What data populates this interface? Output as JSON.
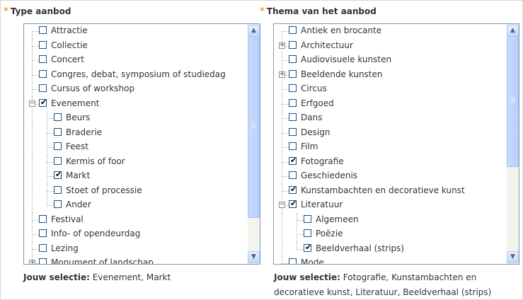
{
  "left": {
    "title": "Type aanbod",
    "selection_label": "Jouw selectie:",
    "selection_value": "Evenement, Markt",
    "items": [
      {
        "label": "Attractie",
        "checked": false,
        "level": 0,
        "expander": ""
      },
      {
        "label": "Collectie",
        "checked": false,
        "level": 0,
        "expander": ""
      },
      {
        "label": "Concert",
        "checked": false,
        "level": 0,
        "expander": ""
      },
      {
        "label": "Congres, debat, symposium of studiedag",
        "checked": false,
        "level": 0,
        "expander": ""
      },
      {
        "label": "Cursus of workshop",
        "checked": false,
        "level": 0,
        "expander": ""
      },
      {
        "label": "Evenement",
        "checked": true,
        "level": 0,
        "expander": "−"
      },
      {
        "label": "Beurs",
        "checked": false,
        "level": 1,
        "expander": ""
      },
      {
        "label": "Braderie",
        "checked": false,
        "level": 1,
        "expander": ""
      },
      {
        "label": "Feest",
        "checked": false,
        "level": 1,
        "expander": ""
      },
      {
        "label": "Kermis of foor",
        "checked": false,
        "level": 1,
        "expander": ""
      },
      {
        "label": "Markt",
        "checked": true,
        "level": 1,
        "expander": ""
      },
      {
        "label": "Stoet of processie",
        "checked": false,
        "level": 1,
        "expander": ""
      },
      {
        "label": "Ander",
        "checked": false,
        "level": 1,
        "expander": ""
      },
      {
        "label": "Festival",
        "checked": false,
        "level": 0,
        "expander": ""
      },
      {
        "label": "Info- of opendeurdag",
        "checked": false,
        "level": 0,
        "expander": ""
      },
      {
        "label": "Lezing",
        "checked": false,
        "level": 0,
        "expander": ""
      },
      {
        "label": "Monument of landschap",
        "checked": false,
        "level": 0,
        "expander": "+"
      }
    ],
    "scroll_position": 0.0
  },
  "right": {
    "title": "Thema van het aanbod",
    "selection_label": "Jouw selectie:",
    "selection_value": "Fotografie, Kunstambachten en decoratieve kunst, Literatuur, Beeldverhaal (strips)",
    "items": [
      {
        "label": "Antiek en brocante",
        "checked": false,
        "level": 0,
        "expander": ""
      },
      {
        "label": "Architectuur",
        "checked": false,
        "level": 0,
        "expander": "+"
      },
      {
        "label": "Audiovisuele kunsten",
        "checked": false,
        "level": 0,
        "expander": ""
      },
      {
        "label": "Beeldende kunsten",
        "checked": false,
        "level": 0,
        "expander": "+"
      },
      {
        "label": "Circus",
        "checked": false,
        "level": 0,
        "expander": ""
      },
      {
        "label": "Erfgoed",
        "checked": false,
        "level": 0,
        "expander": ""
      },
      {
        "label": "Dans",
        "checked": false,
        "level": 0,
        "expander": ""
      },
      {
        "label": "Design",
        "checked": false,
        "level": 0,
        "expander": ""
      },
      {
        "label": "Film",
        "checked": false,
        "level": 0,
        "expander": ""
      },
      {
        "label": "Fotografie",
        "checked": true,
        "level": 0,
        "expander": ""
      },
      {
        "label": "Geschiedenis",
        "checked": false,
        "level": 0,
        "expander": ""
      },
      {
        "label": "Kunstambachten en decoratieve kunst",
        "checked": true,
        "level": 0,
        "expander": ""
      },
      {
        "label": "Literatuur",
        "checked": true,
        "level": 0,
        "expander": "−"
      },
      {
        "label": "Algemeen",
        "checked": false,
        "level": 1,
        "expander": ""
      },
      {
        "label": "Poëzie",
        "checked": false,
        "level": 1,
        "expander": ""
      },
      {
        "label": "Beeldverhaal (strips)",
        "checked": true,
        "level": 1,
        "expander": ""
      },
      {
        "label": "Mode",
        "checked": false,
        "level": 0,
        "expander": ""
      }
    ],
    "scroll_position": 0.0
  },
  "colors": {
    "required_star": "#f2a418",
    "box_border": "#7f9db9",
    "scrollbar_thumb": "#b9cffb"
  },
  "icons": {
    "required": "asterisk-icon",
    "checked": "checkmark-icon",
    "expand": "plus-icon",
    "collapse": "minus-icon",
    "scroll_up": "chevron-up-icon",
    "scroll_down": "chevron-down-icon"
  }
}
